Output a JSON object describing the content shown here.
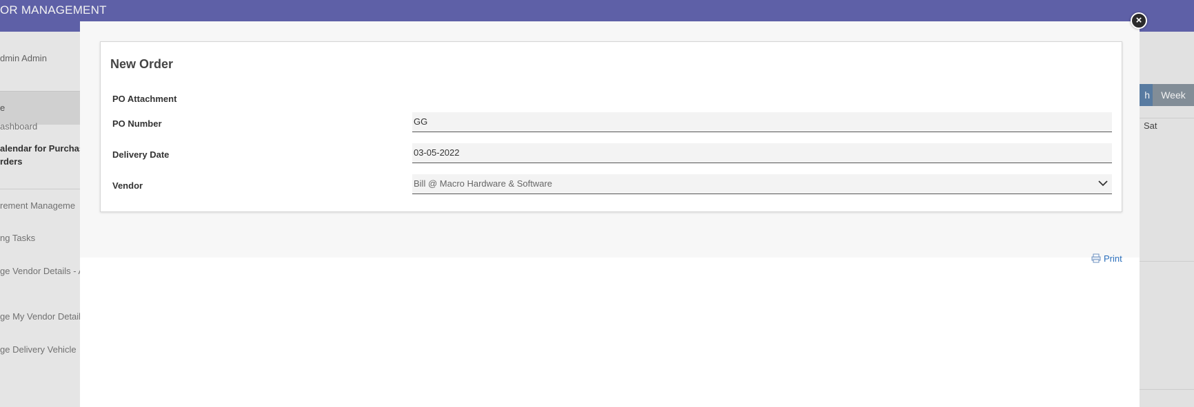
{
  "app": {
    "title": "OR MANAGEMENT"
  },
  "sidebar": {
    "user": "dmin Admin",
    "section": "e",
    "items": [
      {
        "label": "ashboard"
      },
      {
        "label_line1": "alendar for Purchas",
        "label_line2": "rders"
      },
      {
        "label": "rement Manageme"
      },
      {
        "label": "ng Tasks"
      },
      {
        "label": "ge Vendor Details - A"
      },
      {
        "label": "ge My Vendor Details"
      },
      {
        "label": "ge Delivery Vehicle"
      }
    ]
  },
  "calendar": {
    "btn_left": "h",
    "btn_week": "Week",
    "day_sat": "Sat"
  },
  "modal": {
    "title": "New Order",
    "fields": {
      "po_attachment": {
        "label": "PO Attachment"
      },
      "po_number": {
        "label": "PO Number",
        "value": "GG"
      },
      "delivery_date": {
        "label": "Delivery Date",
        "value": "03-05-2022"
      },
      "vendor": {
        "label": "Vendor",
        "value": "Bill @ Macro Hardware & Software"
      }
    },
    "print_label": "Print",
    "close_icon": "close-icon"
  },
  "colors": {
    "header": "#6466b0",
    "accent_link": "#2a6ebb",
    "button_week": "#8a95a0",
    "button_left": "#5d82aa"
  }
}
